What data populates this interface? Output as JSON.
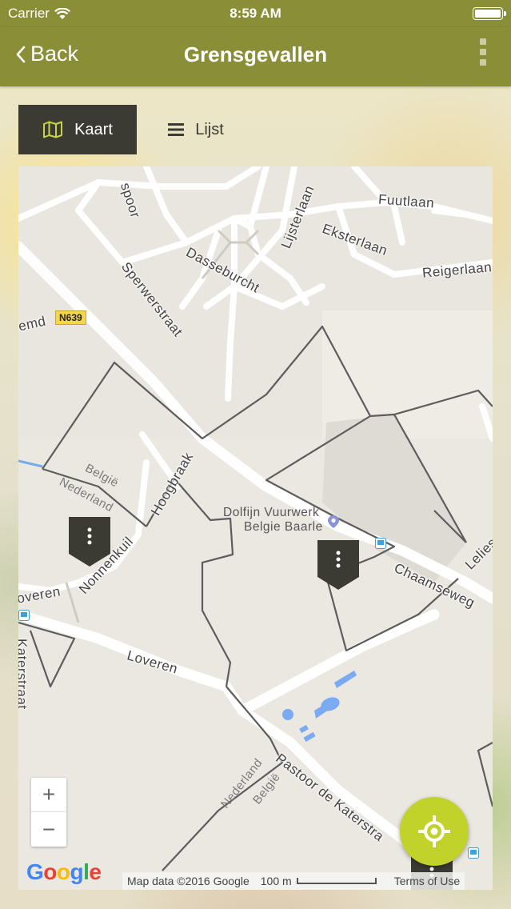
{
  "status_bar": {
    "carrier": "Carrier",
    "time": "8:59 AM"
  },
  "nav": {
    "back_label": "Back",
    "title": "Grensgevallen"
  },
  "tabs": [
    {
      "label": "Kaart",
      "icon": "map-icon",
      "active": true
    },
    {
      "label": "Lijst",
      "icon": "list-icon",
      "active": false
    }
  ],
  "map": {
    "street_labels": {
      "spoor": "spoor",
      "fuutlaan": "Fuutlaan",
      "lijsterlaan": "Lijsterlaan",
      "eksterlaan": "Eksterlaan",
      "reigerlaan": "Reigerlaan",
      "dasseburcht": "Dasseburcht",
      "sperwerstraat": "Sperwerstraat",
      "emd": "emd",
      "hoogbraak": "Hoogbraak",
      "nonnenkuil": "Nonnenkuil",
      "chaamseweg": "Chaamseweg",
      "leliestr": "Lelies",
      "loveren": "Loveren",
      "loveren_left": "overen",
      "pastoor": "Pastoor de Katerstra",
      "katerstraat_left": "Katerstraat"
    },
    "road_shield": "N639",
    "poi": {
      "line1": "Dolfijn Vuurwerk",
      "line2": "Belgie Baarle"
    },
    "border_labels": {
      "belgie_top": "België",
      "nederland_top": "Nederland",
      "nederland_bottom": "Nederland",
      "belgie_bottom": "België"
    },
    "zoom_in": "+",
    "zoom_out": "−",
    "attribution": "Map data ©2016 Google",
    "scale_label": "100 m",
    "terms": "Terms of Use",
    "google_logo": "Google"
  },
  "colors": {
    "header": "#8a8f37",
    "tab_active": "#3b3b33",
    "accent_button": "#c1d22a",
    "marker": "#3b3b33"
  }
}
